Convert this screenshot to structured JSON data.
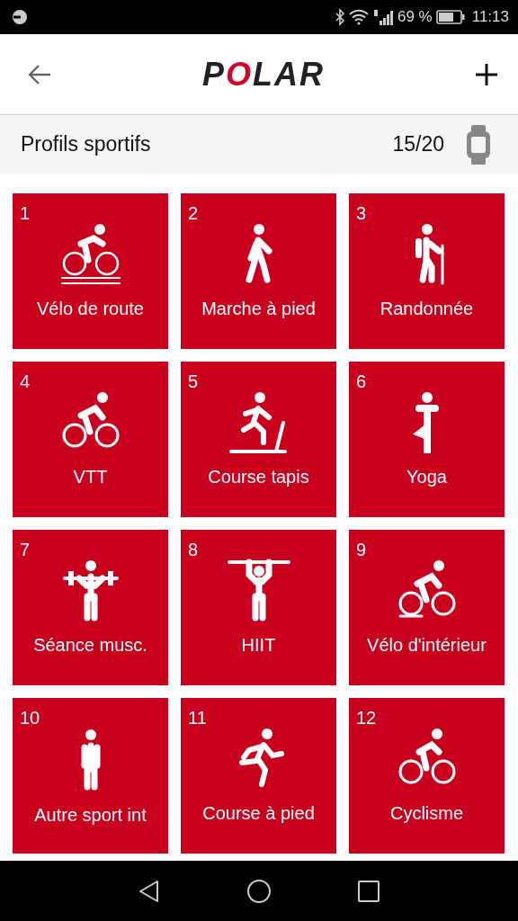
{
  "status_bar": {
    "battery": "69 %",
    "time": "11:13"
  },
  "app_bar": {
    "logo": "POLAR"
  },
  "header": {
    "title": "Profils sportifs",
    "count": "15/20"
  },
  "profiles": [
    {
      "number": "1",
      "label": "Vélo de route"
    },
    {
      "number": "2",
      "label": "Marche à pied"
    },
    {
      "number": "3",
      "label": "Randonnée"
    },
    {
      "number": "4",
      "label": "VTT"
    },
    {
      "number": "5",
      "label": "Course tapis"
    },
    {
      "number": "6",
      "label": "Yoga"
    },
    {
      "number": "7",
      "label": "Séance musc."
    },
    {
      "number": "8",
      "label": "HIIT"
    },
    {
      "number": "9",
      "label": "Vélo d'intérieur"
    },
    {
      "number": "10",
      "label": "Autre sport int"
    },
    {
      "number": "11",
      "label": "Course à pied"
    },
    {
      "number": "12",
      "label": "Cyclisme"
    }
  ]
}
